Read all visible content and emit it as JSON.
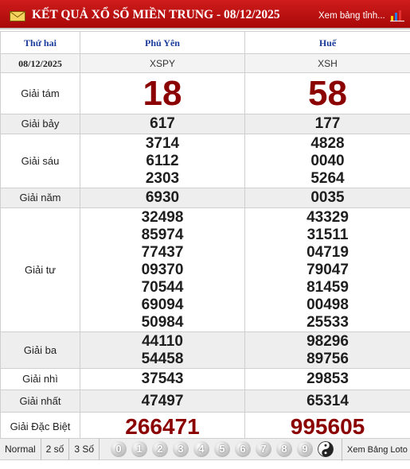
{
  "header": {
    "title": "KẾT QUẢ XỔ SỐ MIỀN TRUNG - 08/12/2025",
    "link": "Xem bảng tỉnh..."
  },
  "table": {
    "day": "Thứ hai",
    "date": "08/12/2025",
    "provinces": [
      {
        "name": "Phú Yên",
        "code": "XSPY"
      },
      {
        "name": "Huế",
        "code": "XSH"
      }
    ],
    "prizes": [
      {
        "label": "Giải tám",
        "values": [
          [
            "18"
          ],
          [
            "58"
          ]
        ]
      },
      {
        "label": "Giải bảy",
        "values": [
          [
            "617"
          ],
          [
            "177"
          ]
        ]
      },
      {
        "label": "Giải sáu",
        "values": [
          [
            "3714",
            "6112",
            "2303"
          ],
          [
            "4828",
            "0040",
            "5264"
          ]
        ]
      },
      {
        "label": "Giải năm",
        "values": [
          [
            "6930"
          ],
          [
            "0035"
          ]
        ]
      },
      {
        "label": "Giải tư",
        "values": [
          [
            "32498",
            "85974",
            "77437",
            "09370",
            "70544",
            "69094",
            "50984"
          ],
          [
            "43329",
            "31511",
            "04719",
            "79047",
            "81459",
            "00498",
            "25533"
          ]
        ]
      },
      {
        "label": "Giải ba",
        "values": [
          [
            "44110",
            "54458"
          ],
          [
            "98296",
            "89756"
          ]
        ]
      },
      {
        "label": "Giải nhì",
        "values": [
          [
            "37543"
          ],
          [
            "29853"
          ]
        ]
      },
      {
        "label": "Giải nhất",
        "values": [
          [
            "47497"
          ],
          [
            "65314"
          ]
        ]
      },
      {
        "label": "Giải Đặc Biệt",
        "values": [
          [
            "266471"
          ],
          [
            "995605"
          ]
        ]
      }
    ]
  },
  "footer": {
    "buttons": [
      "Normal",
      "2 số",
      "3 Số"
    ],
    "digits": [
      "0",
      "1",
      "2",
      "3",
      "4",
      "5",
      "6",
      "7",
      "8",
      "9"
    ],
    "link": "Xem Bảng Loto"
  },
  "colors": {
    "header_bg": "#c01212",
    "province_text": "#1a3c9c",
    "highlight_number": "#8b0000"
  }
}
